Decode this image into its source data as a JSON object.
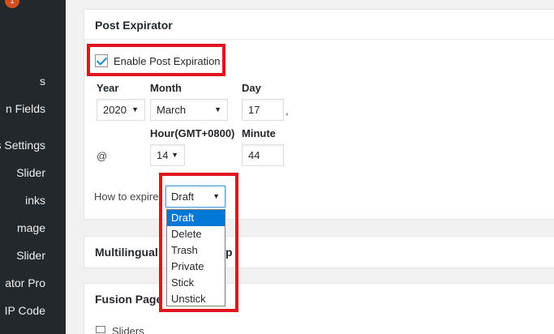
{
  "sidebar": {
    "badge": "1",
    "items": [
      "s",
      "n Fields",
      "s Settings",
      "Slider",
      "inks",
      "mage",
      "Slider",
      "ator Pro",
      "IP Code"
    ]
  },
  "post_expirator": {
    "title": "Post Expirator",
    "enable_label": "Enable Post Expiration",
    "enabled": true,
    "year_label": "Year",
    "month_label": "Month",
    "day_label": "Day",
    "year_value": "2020",
    "month_value": "March",
    "day_value": "17",
    "comma": ",",
    "hour_label": "Hour(GMT+0800)",
    "minute_label": "Minute",
    "at_symbol": "@",
    "hour_value": "14",
    "minute_value": "44",
    "how_label": "How to expire",
    "how_value": "Draft",
    "how_options": [
      "Draft",
      "Delete",
      "Trash",
      "Private",
      "Stick",
      "Unstick"
    ]
  },
  "multilingual": {
    "title": "Multilingual",
    "title_tail": "p"
  },
  "fusion": {
    "title": "Fusion Page",
    "sliders_label": "Sliders"
  },
  "colors": {
    "annotation": "#e0141e",
    "highlight": "#0078d7",
    "sidebar_bg": "#23282d"
  }
}
